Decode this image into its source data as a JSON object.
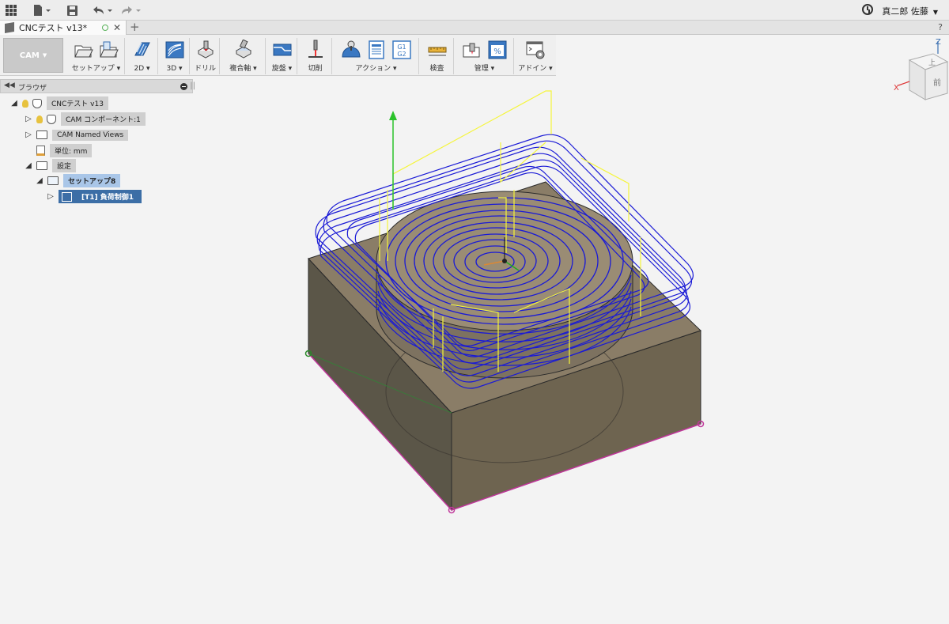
{
  "window": {
    "user_name": "真二郎 佐藤"
  },
  "document_tab": {
    "title": "CNCテスト v13*"
  },
  "ribbon": {
    "workspace_label": "CAM",
    "groups": [
      {
        "label": "セットアップ ▾"
      },
      {
        "label": "2D ▾"
      },
      {
        "label": "3D ▾"
      },
      {
        "label": "ドリル"
      },
      {
        "label": "複合軸 ▾"
      },
      {
        "label": "旋盤 ▾"
      },
      {
        "label": "切削"
      },
      {
        "label": "アクション ▾"
      },
      {
        "label": "検査"
      },
      {
        "label": "管理 ▾"
      },
      {
        "label": "アドイン ▾"
      }
    ],
    "action_g_code_label": "G1\nG2"
  },
  "browser": {
    "title": "ブラウザ",
    "tree": {
      "root": "CNCテスト v13",
      "cam_component": "CAM コンポーネント:1",
      "named_views": "CAM Named Views",
      "units": "単位: mm",
      "settings": "設定",
      "setup": "セットアップ8",
      "operation": "[T1] 負荷制御1"
    }
  },
  "viewcube": {
    "axis_z": "Z",
    "axis_x": "X",
    "face_top": "上",
    "face_front": "前"
  },
  "colors": {
    "toolpath": "#1a1ad6",
    "rapid": "#f5f53a",
    "stock_side": "#5b5648",
    "stock_top": "#7a705e",
    "boundary": "#c0369a"
  }
}
